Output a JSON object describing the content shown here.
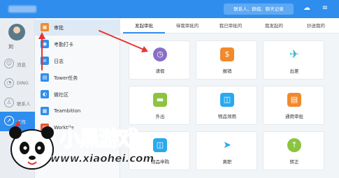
{
  "topbar": {
    "search_placeholder": "联系人、群组、聊天记录"
  },
  "rail": {
    "user_name": "刘",
    "items": [
      {
        "label": "消息"
      },
      {
        "label": "DING"
      },
      {
        "label": "联系人"
      },
      {
        "label": "工作"
      }
    ]
  },
  "sidebar": {
    "items": [
      {
        "label": "审批",
        "color": "#f08a2c",
        "glyph": "▣"
      },
      {
        "label": "考勤打卡",
        "color": "#2f8ded",
        "glyph": "◉"
      },
      {
        "label": "日志",
        "color": "#2f8ded",
        "glyph": "≡"
      },
      {
        "label": "Tower任务",
        "color": "#2f8ded",
        "glyph": "▤"
      },
      {
        "label": "微社区",
        "color": "#2f8ded",
        "glyph": "◐"
      },
      {
        "label": "Teambition",
        "color": "#2f8ded",
        "glyph": "▦"
      },
      {
        "label": "Worktile",
        "color": "#f0552c",
        "glyph": "▥"
      }
    ]
  },
  "tabs": [
    {
      "label": "发起审批"
    },
    {
      "label": "待我审批的"
    },
    {
      "label": "我已审批的"
    },
    {
      "label": "我发起的"
    },
    {
      "label": "抄送我的"
    }
  ],
  "cards": [
    {
      "label": "请假",
      "color": "#8a6fc8",
      "glyph": "◷"
    },
    {
      "label": "报销",
      "color": "#f08a2c",
      "glyph": "$"
    },
    {
      "label": "出差",
      "color": "#29b6c6",
      "glyph": "✈"
    },
    {
      "label": "外出",
      "color": "#8bc53f",
      "glyph": "▬"
    },
    {
      "label": "物品领用",
      "color": "#29a9ef",
      "glyph": "◫"
    },
    {
      "label": "通用审批",
      "color": "#f08a2c",
      "glyph": "▤"
    },
    {
      "label": "物品申购",
      "color": "#29a9ef",
      "glyph": "◫"
    },
    {
      "label": "离职",
      "color": "#29a9ef",
      "glyph": "➤"
    },
    {
      "label": "转正",
      "color": "#8bc53f",
      "glyph": "↑"
    }
  ],
  "watermark": {
    "title": "小黑游戏",
    "url": "www.xiaohei.com"
  },
  "colors": {
    "accent": "#2f8ded",
    "arrow": "#e8322c"
  }
}
